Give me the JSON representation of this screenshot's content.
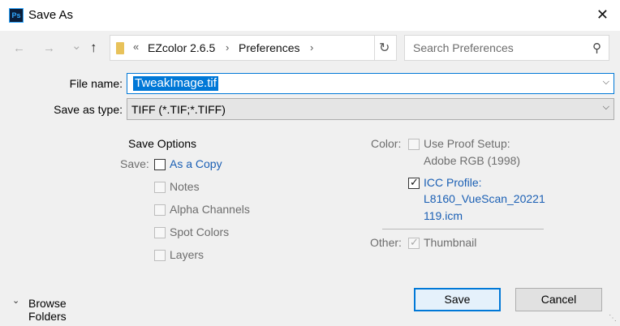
{
  "window": {
    "app_icon": "Ps",
    "title": "Save As",
    "close_icon": "✕"
  },
  "nav": {
    "back_icon": "←",
    "forward_icon": "→",
    "recent_icon": "⌄",
    "up_icon": "↑",
    "overflow": "«",
    "breadcrumb": [
      "EZcolor 2.6.5",
      "Preferences"
    ],
    "breadcrumb_sep": "›",
    "refresh_icon": "↻"
  },
  "search": {
    "placeholder": "Search Preferences",
    "icon": "⚲"
  },
  "form": {
    "file_name_label": "File name:",
    "file_name_value": "TweakImage.tif",
    "save_type_label": "Save as type:",
    "save_type_value": "TIFF (*.TIF;*.TIFF)"
  },
  "options": {
    "heading": "Save Options",
    "save_label": "Save:",
    "save_items": [
      {
        "label": "As a Copy",
        "checked": false,
        "enabled": true
      },
      {
        "label": "Notes",
        "checked": false,
        "enabled": false
      },
      {
        "label": "Alpha Channels",
        "checked": false,
        "enabled": false
      },
      {
        "label": "Spot Colors",
        "checked": false,
        "enabled": false
      },
      {
        "label": "Layers",
        "checked": false,
        "enabled": false
      }
    ],
    "color_label": "Color:",
    "proof_setup_line1": "Use Proof Setup:",
    "proof_setup_line2": "Adobe RGB (1998)",
    "icc_line1": "ICC Profile:",
    "icc_line2": "L8160_VueScan_20221",
    "icc_line3": "119.icm",
    "other_label": "Other:",
    "thumbnail_label": "Thumbnail"
  },
  "footer": {
    "browse_label": "Browse Folders",
    "browse_icon": "⌄",
    "save_button": "Save",
    "cancel_button": "Cancel"
  },
  "colors": {
    "accent": "#0078d7",
    "link_text": "#1a5fb4",
    "disabled_text": "#6d6d6d"
  }
}
